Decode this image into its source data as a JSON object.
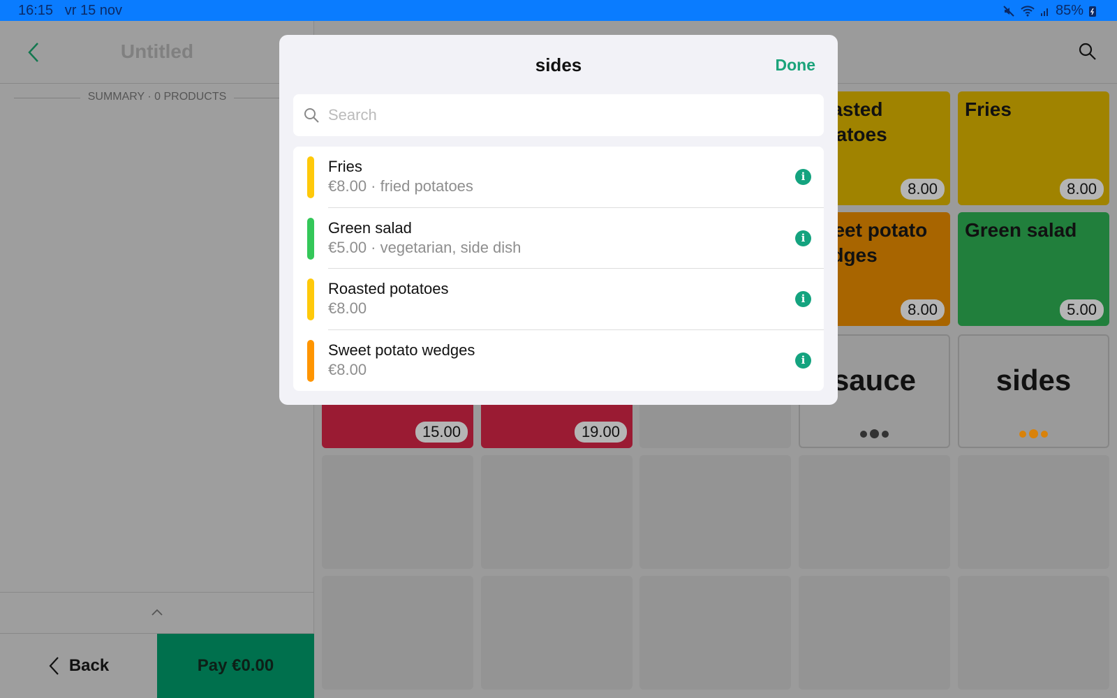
{
  "status_bar": {
    "time": "16:15",
    "date": "vr 15 nov",
    "battery": "85%"
  },
  "order": {
    "title": "Untitled",
    "summary": "SUMMARY · 0 PRODUCTS",
    "back_label": "Back",
    "pay_label": "Pay €0.00"
  },
  "grid": {
    "products": [
      {
        "name": "Roasted potatoes",
        "price": "8.00",
        "color": "#a08300"
      },
      {
        "name": "Fries",
        "price": "8.00",
        "color": "#a08300"
      },
      {
        "name": "Sweet potato wedges",
        "price": "8.00",
        "color": "#a86500"
      },
      {
        "name": "Green salad",
        "price": "5.00",
        "color": "#217f3c"
      },
      {
        "name": "",
        "price": "15.00",
        "color": "#9a1b33"
      },
      {
        "name": "",
        "price": "19.00",
        "color": "#9a1b33"
      }
    ],
    "categories": [
      {
        "name": "sauce",
        "dot_color": "#333333"
      },
      {
        "name": "sides",
        "dot_color": "#d9820a"
      }
    ]
  },
  "modal": {
    "title": "sides",
    "done_label": "Done",
    "search_placeholder": "Search",
    "search_value": "",
    "items": [
      {
        "name": "Fries",
        "subtitle": "€8.00 · fried potatoes",
        "color": "#ffc90a"
      },
      {
        "name": "Green salad",
        "subtitle": "€5.00 · vegetarian, side dish",
        "color": "#34c759"
      },
      {
        "name": "Roasted potatoes",
        "subtitle": "€8.00",
        "color": "#ffc90a"
      },
      {
        "name": "Sweet potato wedges",
        "subtitle": "€8.00",
        "color": "#ff9500"
      }
    ]
  }
}
